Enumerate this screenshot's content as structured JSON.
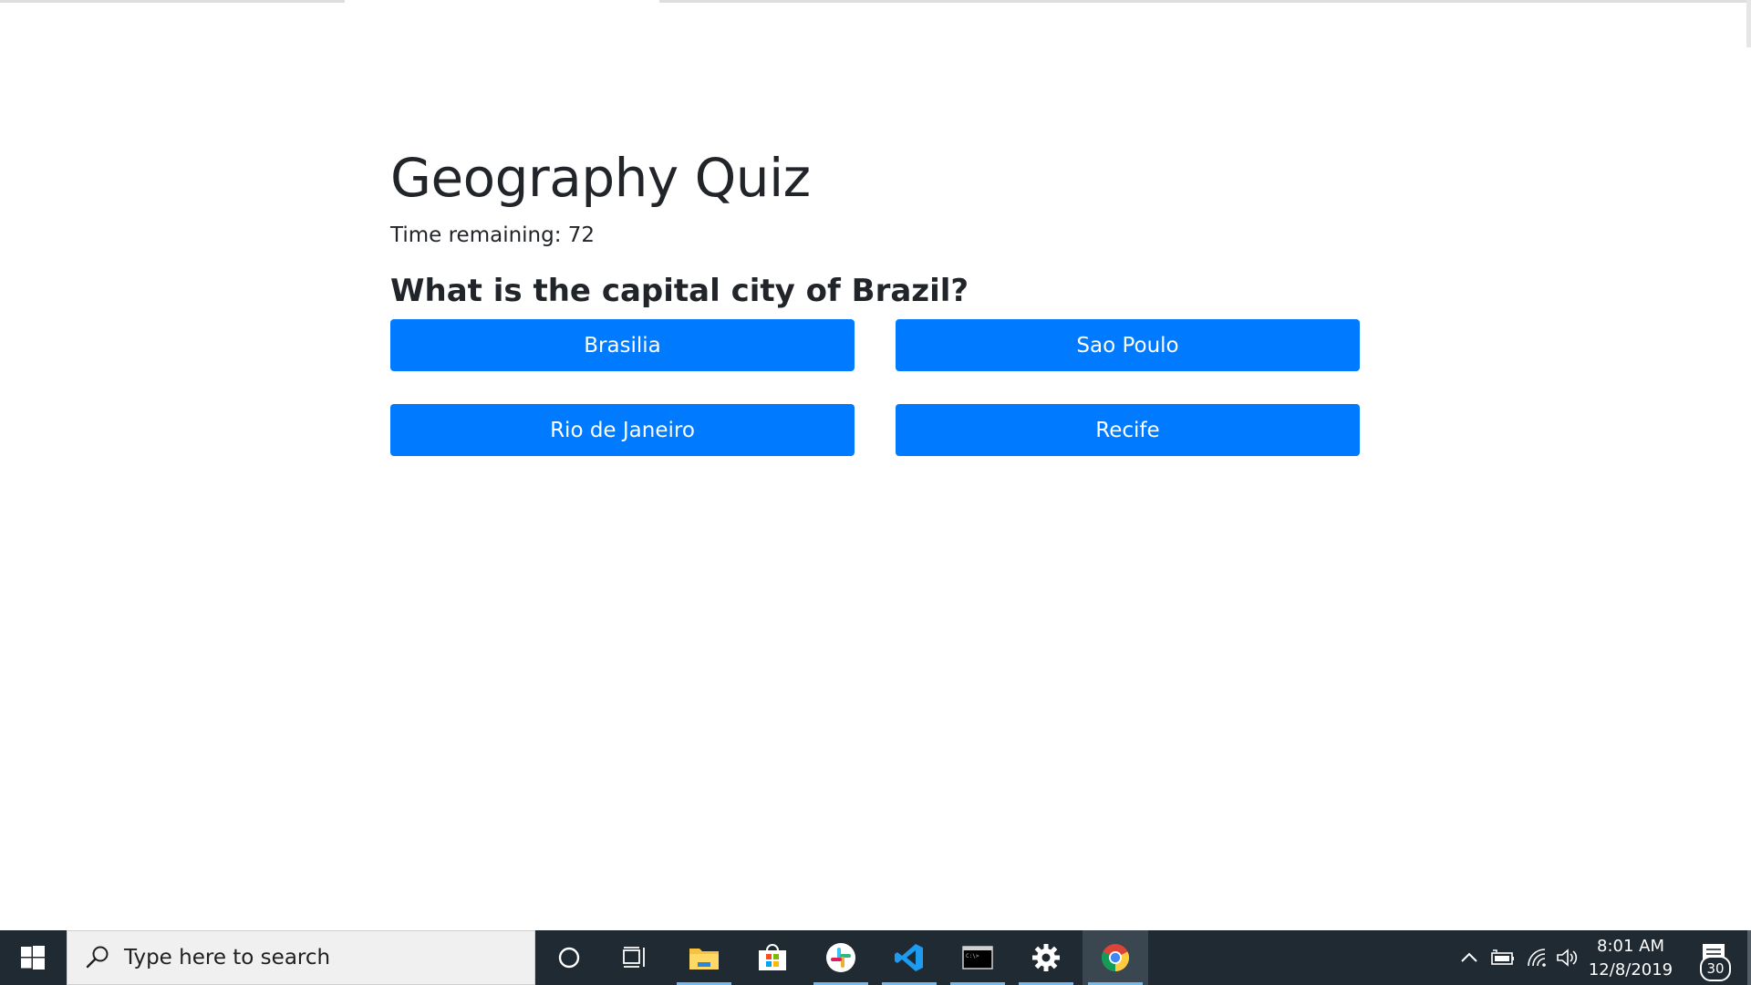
{
  "page": {
    "title": "Geography Quiz",
    "timer_label": "Time remaining: 72",
    "question": "What is the capital city of Brazil?",
    "answers": [
      {
        "label": "Brasilia"
      },
      {
        "label": "Sao Poulo"
      },
      {
        "label": "Rio de Janeiro"
      },
      {
        "label": "Recife"
      }
    ],
    "button_color": "#007bff"
  },
  "taskbar": {
    "search_placeholder": "Type here to search",
    "pinned_icons": [
      "cortana-icon",
      "task-view-icon",
      "file-explorer-icon",
      "microsoft-store-icon",
      "slack-icon",
      "vscode-icon",
      "terminal-icon",
      "settings-icon",
      "chrome-icon"
    ],
    "clock_time": "8:01 AM",
    "clock_date": "12/8/2019",
    "notification_count": "30",
    "background_color": "#1f2a33"
  }
}
